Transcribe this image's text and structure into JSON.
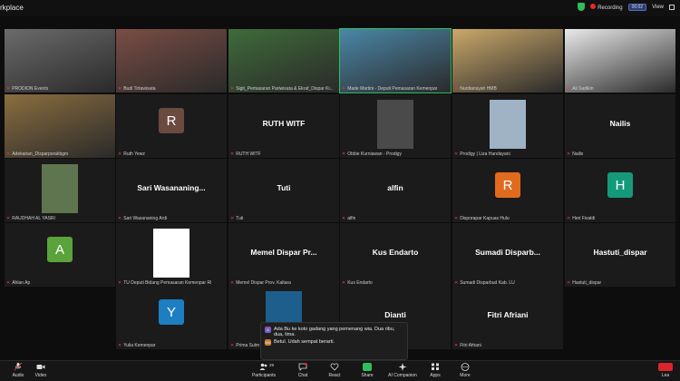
{
  "app": {
    "title": "rkplace"
  },
  "topbar": {
    "recording_label": "Recording",
    "timer": "00:02",
    "view_label": "View"
  },
  "tiles": [
    {
      "name": "PRODION Events",
      "type": "video",
      "bg": "#6b6b6b"
    },
    {
      "name": "Budi Tirtawisata",
      "type": "video",
      "bg": "#7a4d45"
    },
    {
      "name": "Sigit_Pemasaran Pariwisata & Ekraf_Dispar Ki...",
      "type": "video",
      "bg": "#3f6b3a"
    },
    {
      "name": "Made Martini - Deputi Pemasaran Kemenpar",
      "type": "video",
      "bg": "#4b87a8",
      "active": true
    },
    {
      "name": "Nurdiansyah HMB",
      "type": "video",
      "bg": "#caa86a"
    },
    {
      "name": "Ali Sadikin",
      "type": "video",
      "bg": "#e9e9e9"
    },
    {
      "name": "Adekarian_Disparporakbgm",
      "type": "video",
      "bg": "#8b6e3f"
    },
    {
      "name": "Ruth Yewz",
      "type": "avatar",
      "letter": "R",
      "color": "#6b4a3f"
    },
    {
      "name": "RUTH WITF",
      "type": "text",
      "label": "RUTH WITF"
    },
    {
      "name": "Obbie Kurniawan - Prodigy",
      "type": "photo",
      "bg": "#4a4a4a"
    },
    {
      "name": "Prodigy | Liza Handayani",
      "type": "photo",
      "bg": "#9fb3c4"
    },
    {
      "name": "Nailis",
      "type": "text",
      "label": "Nailis"
    },
    {
      "name": "RAUDHAH AL YASRI",
      "type": "photo",
      "bg": "#5f7550"
    },
    {
      "name": "Sari Wasananing Ardi",
      "type": "text",
      "label": "Sari  Wasananing..."
    },
    {
      "name": "Tuti",
      "type": "text",
      "label": "Tuti"
    },
    {
      "name": "alfin",
      "type": "text",
      "label": "alfin"
    },
    {
      "name": "Disporapar Kapuas Hulu",
      "type": "avatar",
      "letter": "R",
      "color": "#e06b1f"
    },
    {
      "name": "Heri Fivaldi",
      "type": "avatar",
      "letter": "H",
      "color": "#149a7b"
    },
    {
      "name": "Ahlan Ap",
      "type": "avatar",
      "letter": "A",
      "color": "#5aa33a"
    },
    {
      "name": "TU Deputi Bidang Pemasaran Kemenpar RI",
      "type": "photo",
      "bg": "#ffffff"
    },
    {
      "name": "Memel Dispar Prov. Kaltara",
      "type": "text",
      "label": "Memel Dispar Pr..."
    },
    {
      "name": "Kus Endarto",
      "type": "text",
      "label": "Kus Endarto"
    },
    {
      "name": "Sumadi Disparbud Kab. LU",
      "type": "text",
      "label": "Sumadi  Disparb..."
    },
    {
      "name": "Hastuti_dispar",
      "type": "text",
      "label": "Hastuti_dispar"
    },
    {
      "name": "",
      "type": "empty"
    },
    {
      "name": "Yulia Kemenpar",
      "type": "avatar",
      "letter": "Y",
      "color": "#1e7ec2"
    },
    {
      "name": "Prima Sulm",
      "type": "photo",
      "bg": "#1d5e8c"
    },
    {
      "name": "Dianti",
      "type": "text",
      "label": "Dianti"
    },
    {
      "name": "Fitri Afriani",
      "type": "text",
      "label": "Fitri Afriani"
    },
    {
      "name": "",
      "type": "empty"
    }
  ],
  "chat_popup": {
    "messages": [
      {
        "initial": "A",
        "color": "#7b5cc4",
        "text": "Ada Bu ke koto gadang yang pemenang wia. Dua ribu, dua, lima."
      },
      {
        "initial": "MM",
        "color": "#c97a2b",
        "text": "Betul. Udah sempat berarti."
      }
    ]
  },
  "toolbar": {
    "audio": "Audio",
    "video": "Video",
    "participants": "Participants",
    "participants_count": "29",
    "chat": "Chat",
    "react": "React",
    "share": "Share",
    "ai_companion": "AI Companion",
    "apps": "Apps",
    "more": "More",
    "leave": "Lea"
  }
}
